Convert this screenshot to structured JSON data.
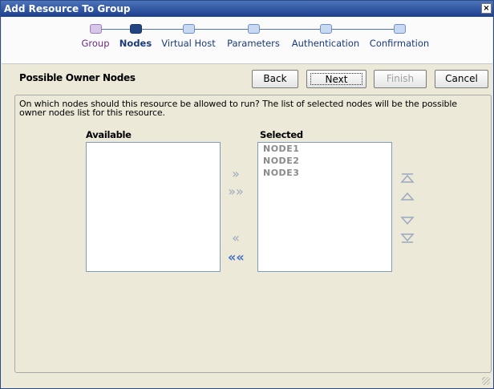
{
  "window": {
    "title": "Add Resource To Group",
    "close_label": "×"
  },
  "wizard": {
    "steps": [
      {
        "label": "Group",
        "state": "done"
      },
      {
        "label": "Nodes",
        "state": "current"
      },
      {
        "label": "Virtual Host",
        "state": "pending"
      },
      {
        "label": "Parameters",
        "state": "pending"
      },
      {
        "label": "Authentication",
        "state": "pending"
      },
      {
        "label": "Confirmation",
        "state": "pending"
      }
    ]
  },
  "section": {
    "title": "Possible Owner Nodes"
  },
  "buttons": {
    "back": "Back",
    "next": "Next",
    "finish": "Finish",
    "cancel": "Cancel"
  },
  "instructions": "On which nodes should this resource be allowed to run?  The list of selected nodes will be the possible owner nodes list for this resource.",
  "available": {
    "heading": "Available",
    "items": []
  },
  "selected": {
    "heading": "Selected",
    "items": [
      "NODE1",
      "NODE2",
      "NODE3"
    ]
  },
  "move_buttons": {
    "add_one": "»",
    "add_all": "»»",
    "remove_one": "«",
    "remove_all": "««"
  },
  "order_buttons": [
    "move-to-top",
    "move-up",
    "move-down",
    "move-to-bottom"
  ]
}
